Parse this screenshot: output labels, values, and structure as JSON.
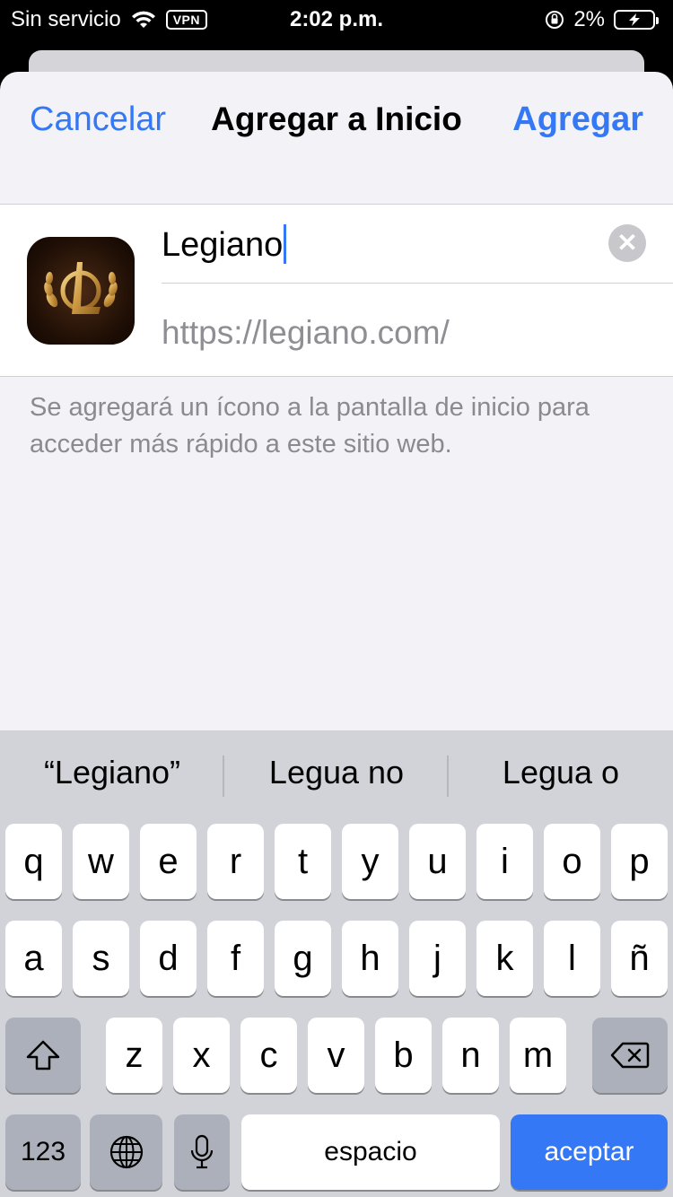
{
  "status_bar": {
    "carrier": "Sin servicio",
    "vpn": "VPN",
    "time": "2:02 p.m.",
    "battery": "2%"
  },
  "nav": {
    "cancel": "Cancelar",
    "title": "Agregar a Inicio",
    "add": "Agregar"
  },
  "form": {
    "name_value": "Legiano",
    "url": "https://legiano.com/",
    "clear_glyph": "✕"
  },
  "hint": "Se agregará un ícono a la pantalla de inicio para acceder más rápido a este sitio web.",
  "keyboard": {
    "suggestions": [
      "“Legiano”",
      "Legua no",
      "Legua o"
    ],
    "row1": [
      "q",
      "w",
      "e",
      "r",
      "t",
      "y",
      "u",
      "i",
      "o",
      "p"
    ],
    "row2": [
      "a",
      "s",
      "d",
      "f",
      "g",
      "h",
      "j",
      "k",
      "l",
      "ñ"
    ],
    "row3": [
      "z",
      "x",
      "c",
      "v",
      "b",
      "n",
      "m"
    ],
    "numbers_key": "123",
    "space_key": "espacio",
    "return_key": "aceptar"
  },
  "colors": {
    "accent": "#3478f6",
    "sheet_bg": "#f2f2f7",
    "keyboard_bg": "#d1d3d9"
  }
}
